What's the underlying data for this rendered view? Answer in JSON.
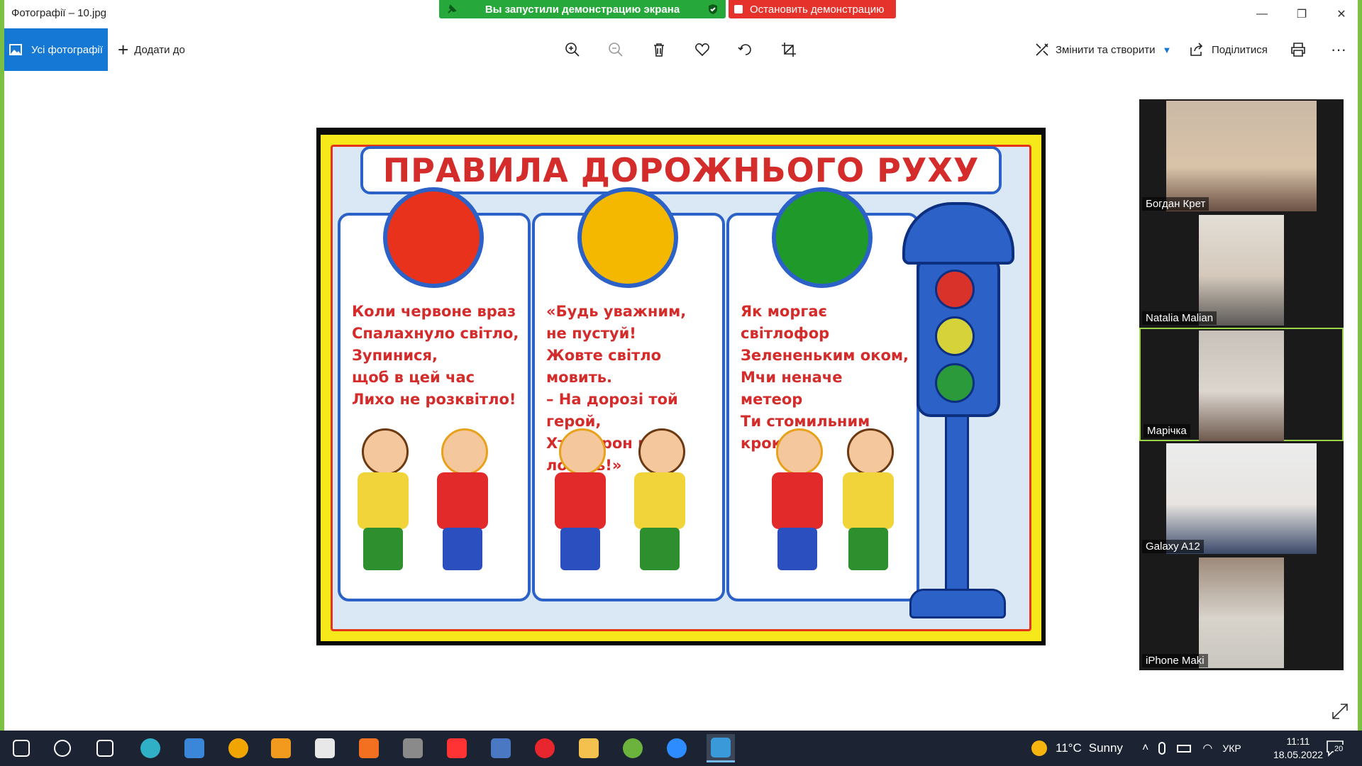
{
  "window": {
    "title": "Фотографії – 10.jpg",
    "minimize_glyph": "—",
    "restore_glyph": "❐",
    "close_glyph": "✕"
  },
  "share": {
    "status_text": "Вы запустили демонстрацию экрана",
    "stop_label": "Остановить демонстрацию"
  },
  "toolbar": {
    "all_photos_label": "Усі фотографії",
    "add_to_label": "Додати до",
    "edit_create_label": "Змінити та створити",
    "share_label": "Поділитися",
    "more_glyph": "···",
    "icons": [
      "zoom-in-icon",
      "zoom-out-icon",
      "trash-icon",
      "heart-icon",
      "rotate-icon",
      "crop-icon",
      "print-icon"
    ]
  },
  "poster": {
    "title": "ПРАВИЛА ДОРОЖНЬОГО РУХУ",
    "panels": [
      {
        "light_color": "#e8321b",
        "poem": "Коли червоне враз\nСпалахнуло світло,\nЗупинися,\n    щоб в цей час\nЛихо не розквітло!"
      },
      {
        "light_color": "#f5b800",
        "poem": "«Будь уважним,\n        не пустуй!\nЖовте світло мовить.\n– На дорозі той герой,\nХто ворон не ловить!»"
      },
      {
        "light_color": "#1f9a2a",
        "poem": "Як моргає світлофор\nЗелененьким оком,\nМчи неначе метеор\nТи стомильним\n              кроком!"
      }
    ]
  },
  "participants": [
    {
      "name": "Богдан Крет",
      "active": false
    },
    {
      "name": "Natalia Malian",
      "active": false
    },
    {
      "name": "Марічка",
      "active": true
    },
    {
      "name": "Galaxy A12",
      "active": false
    },
    {
      "name": "iPhone Maki",
      "active": false
    }
  ],
  "taskbar": {
    "weather_temp": "11°C",
    "weather_text": "Sunny",
    "language": "УКР",
    "time": "11:11",
    "date": "18.05.2022",
    "notification_count": "20",
    "apps": [
      {
        "name": "start-icon",
        "color": "#ffffff"
      },
      {
        "name": "search-icon",
        "color": "#ffffff"
      },
      {
        "name": "task-view-icon",
        "color": "#ffffff"
      },
      {
        "name": "edge-icon",
        "color": "#2fb0c7"
      },
      {
        "name": "store-icon",
        "color": "#3a86d8"
      },
      {
        "name": "triangle-app-icon",
        "color": "#f0a500"
      },
      {
        "name": "media-player-icon",
        "color": "#f29a1e"
      },
      {
        "name": "movie-maker-icon",
        "color": "#e8e8e8"
      },
      {
        "name": "orange-app-icon",
        "color": "#f37021"
      },
      {
        "name": "camera-app-icon",
        "color": "#8a8a8a"
      },
      {
        "name": "yandex-icon",
        "color": "#ff3333"
      },
      {
        "name": "floppy-icon",
        "color": "#4a78c2"
      },
      {
        "name": "opera-icon",
        "color": "#e8262d"
      },
      {
        "name": "file-explorer-icon",
        "color": "#f4c04e"
      },
      {
        "name": "utorrent-icon",
        "color": "#6cb33e"
      },
      {
        "name": "zoom-icon",
        "color": "#2d8cff"
      },
      {
        "name": "photos-icon",
        "color": "#3a9ad9"
      }
    ]
  }
}
